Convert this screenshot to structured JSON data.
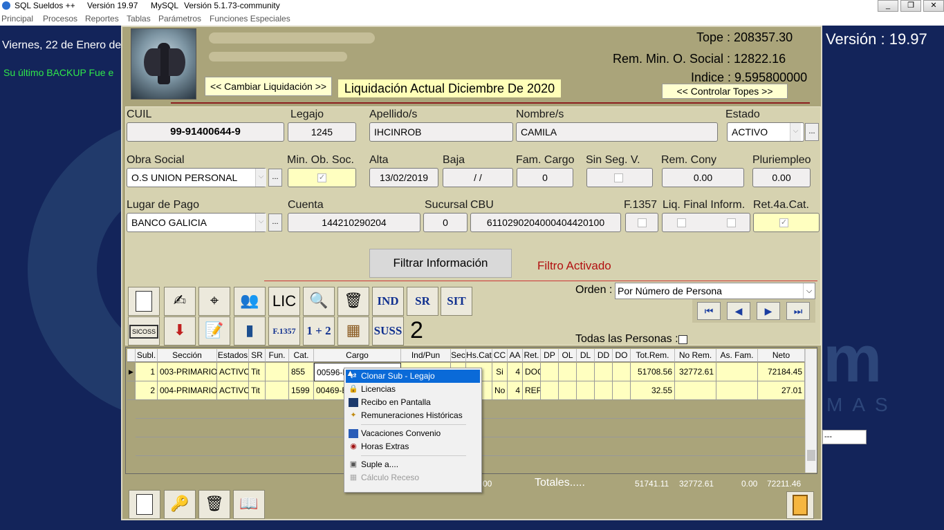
{
  "titlebar": {
    "app": "SQL Sueldos ++",
    "version": "Versión 19.97",
    "db": "MySQL",
    "dbversion": "Versión 5.1.73-community"
  },
  "menu": [
    "Principal",
    "Procesos",
    "Reportes",
    "Tablas",
    "Parámetros",
    "Funciones Especiales"
  ],
  "background": {
    "date": "Viernes, 22 de Enero de",
    "backup": "Su último BACKUP Fue e",
    "version": "Versión : 19.97",
    "dashes": "---"
  },
  "header": {
    "tope": "Tope : 208357.30",
    "rem_min": "Rem. Min. O. Social : 12822.16",
    "indice": "Indice : 9.595800000",
    "cambiar": "<< Cambiar Liquidación >>",
    "liquidacion": "Liquidación Actual Diciembre De 2020",
    "controlar": "<< Controlar Topes >>"
  },
  "employee": {
    "cuil_label": "CUIL",
    "cuil": "99-91400644-9",
    "legajo_label": "Legajo",
    "legajo": "1245",
    "apellido_label": "Apellido/s",
    "apellido": "IHCINROB",
    "nombre_label": "Nombre/s",
    "nombre": "CAMILA",
    "estado_label": "Estado",
    "estado": "ACTIVO",
    "obra_label": "Obra Social",
    "obra": "O.S UNION PERSONAL",
    "minob_label": "Min. Ob. Soc.",
    "alta_label": "Alta",
    "alta": "13/02/2019",
    "baja_label": "Baja",
    "baja": "/   /",
    "famcargo_label": "Fam. Cargo",
    "famcargo": "0",
    "sinseg_label": "Sin Seg. V.",
    "remcony_label": "Rem. Cony",
    "remcony": "0.00",
    "pluri_label": "Pluriempleo",
    "pluri": "0.00",
    "lugar_label": "Lugar de Pago",
    "lugar": "BANCO GALICIA",
    "cuenta_label": "Cuenta",
    "cuenta": "144210290204",
    "sucursal_label": "Sucursal",
    "sucursal": "0",
    "cbu_label": "CBU",
    "cbu": "6110290204000404420100",
    "f1357_label": "F.1357",
    "liqfinal_label": "Liq. Final Inform.",
    "ret4a_label": "Ret.4a.Cat.",
    "minob_checked": true,
    "ret4a_checked": true
  },
  "filter": {
    "button": "Filtrar Información",
    "status": "Filtro Activado"
  },
  "toolbar": {
    "lic": "LIC",
    "ind": "IND",
    "sr": "SR",
    "sit": "SIT",
    "sicoss": "SICOSS",
    "f1357": "F.1357",
    "oneplustwo": "1 + 2",
    "suss": "SUSS",
    "count": "2"
  },
  "orden": {
    "label": "Orden :",
    "value": "Por Número de Persona",
    "todas": "Todas las Personas :"
  },
  "grid": {
    "columns": [
      "Subl.",
      "Sección",
      "Estados",
      "SR",
      "Fun.",
      "Cat.",
      "Cargo",
      "Ind/Pun",
      "Sec",
      "Hs.Cat",
      "CC",
      "AA",
      "Ret.",
      "DP",
      "OL",
      "DL",
      "DD",
      "DO",
      "Tot.Rem.",
      "No Rem.",
      "As. Fam.",
      "Neto"
    ],
    "rows": [
      {
        "subl": "1",
        "seccion": "003-PRIMARIO",
        "estado": "ACTIVO",
        "sr": "Tit",
        "cat": "855",
        "cargo": "00596-N",
        "cc": "Si",
        "aa": "4",
        "ret": "DOC",
        "totrem": "51708.56",
        "norem": "32772.61",
        "neto": "72184.45"
      },
      {
        "subl": "2",
        "seccion": "004-PRIMARIO",
        "estado": "ACTIVO",
        "sr": "Tit",
        "cat": "1599",
        "cargo": "00469-E",
        "cc": "No",
        "aa": "4",
        "ret": "REP",
        "totrem": "32.55",
        "norem": "",
        "neto": "27.01"
      }
    ]
  },
  "totals": {
    "partial": "00",
    "label": "Totales.....",
    "totrem": "51741.11",
    "norem": "32772.61",
    "asfam": "0.00",
    "neto": "72211.46"
  },
  "context_menu": [
    "Clonar Sub - Legajo",
    "Licencias",
    "Recibo en Pantalla",
    "Remuneraciones Históricas",
    "Vacaciones Convenio",
    "Horas Extras",
    "Suple a....",
    "Cálculo Receso"
  ]
}
